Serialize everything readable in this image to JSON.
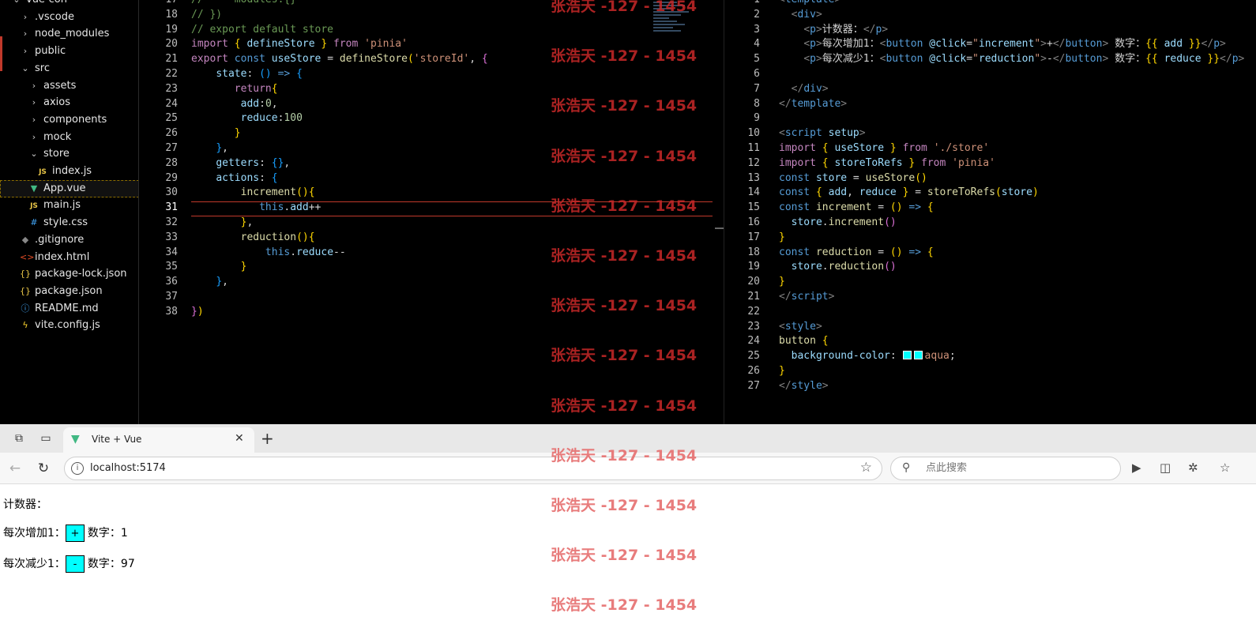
{
  "explorer": {
    "items": [
      {
        "label": "vue-con",
        "icon": "chevron-down-icon",
        "indent": 0
      },
      {
        "label": ".vscode",
        "icon": "chevron-right-icon",
        "indent": 1
      },
      {
        "label": "node_modules",
        "icon": "chevron-right-icon",
        "indent": 1
      },
      {
        "label": "public",
        "icon": "chevron-right-icon",
        "indent": 1
      },
      {
        "label": "src",
        "icon": "chevron-down-icon",
        "indent": 1
      },
      {
        "label": "assets",
        "icon": "chevron-right-icon",
        "indent": 2
      },
      {
        "label": "axios",
        "icon": "chevron-right-icon",
        "indent": 2
      },
      {
        "label": "components",
        "icon": "chevron-right-icon",
        "indent": 2
      },
      {
        "label": "mock",
        "icon": "chevron-right-icon",
        "indent": 2
      },
      {
        "label": "store",
        "icon": "chevron-down-icon",
        "indent": 2
      },
      {
        "label": "index.js",
        "icon": "js-file-icon",
        "indent": 3
      },
      {
        "label": "App.vue",
        "icon": "vue-file-icon",
        "indent": 2,
        "selected": true
      },
      {
        "label": "main.js",
        "icon": "js-file-icon",
        "indent": 2
      },
      {
        "label": "style.css",
        "icon": "css-file-icon",
        "indent": 2
      },
      {
        "label": ".gitignore",
        "icon": "git-file-icon",
        "indent": 1
      },
      {
        "label": "index.html",
        "icon": "html-file-icon",
        "indent": 1
      },
      {
        "label": "package-lock.json",
        "icon": "json-file-icon",
        "indent": 1
      },
      {
        "label": "package.json",
        "icon": "json-file-icon",
        "indent": 1
      },
      {
        "label": "README.md",
        "icon": "info-file-icon",
        "indent": 1
      },
      {
        "label": "vite.config.js",
        "icon": "vite-file-icon",
        "indent": 1
      }
    ]
  },
  "editor_left": {
    "active_line": 31,
    "lines": [
      {
        "n": "17",
        "html": "<span class='cm'>//     modules:{}</span>"
      },
      {
        "n": "18",
        "html": "<span class='cm'>// })</span>"
      },
      {
        "n": "19",
        "html": "<span class='cm'>// export default store</span>"
      },
      {
        "n": "20",
        "html": "<span class='kw'>import</span> <span class='br1'>{</span> <span class='var'>defineStore</span> <span class='br1'>}</span> <span class='kw'>from</span> <span class='str'>'pinia'</span>"
      },
      {
        "n": "21",
        "html": "<span class='kw'>export</span> <span class='kw2'>const</span> <span class='var'>useStore</span> = <span class='fn'>defineStore</span><span class='br1'>(</span><span class='str'>'storeId'</span>, <span class='br2'>{</span>"
      },
      {
        "n": "22",
        "html": "    <span class='var'>state</span>: <span class='br3'>()</span> <span class='kw2'>=&gt;</span> <span class='br3'>{</span>"
      },
      {
        "n": "23",
        "html": "       <span class='kw'>return</span><span class='br1'>{</span>"
      },
      {
        "n": "24",
        "html": "        <span class='var'>add</span>:<span class='num'>0</span>,"
      },
      {
        "n": "25",
        "html": "        <span class='var'>reduce</span>:<span class='num'>100</span>"
      },
      {
        "n": "26",
        "html": "       <span class='br1'>}</span>"
      },
      {
        "n": "27",
        "html": "    <span class='br3'>}</span>,"
      },
      {
        "n": "28",
        "html": "    <span class='var'>getters</span>: <span class='br3'>{}</span>,"
      },
      {
        "n": "29",
        "html": "    <span class='var'>actions</span>: <span class='br3'>{</span>"
      },
      {
        "n": "30",
        "html": "        <span class='fn'>increment</span><span class='br1'>()</span><span class='br1'>{</span>"
      },
      {
        "n": "31",
        "html": "           <span class='kw2'>this</span>.<span class='var'>add</span>++"
      },
      {
        "n": "32",
        "html": "        <span class='br1'>}</span>,"
      },
      {
        "n": "33",
        "html": "        <span class='fn'>reduction</span><span class='br1'>()</span><span class='br1'>{</span>"
      },
      {
        "n": "34",
        "html": "            <span class='kw2'>this</span>.<span class='var'>reduce</span>--"
      },
      {
        "n": "35",
        "html": "        <span class='br1'>}</span>"
      },
      {
        "n": "36",
        "html": "    <span class='br3'>}</span>,"
      },
      {
        "n": "37",
        "html": ""
      },
      {
        "n": "38",
        "html": "<span class='br2'>}</span><span class='br1'>)</span>"
      }
    ]
  },
  "editor_right": {
    "lines": [
      {
        "n": "1",
        "html": "<span class='tag'>&lt;</span><span class='tagn'>template</span><span class='tag'>&gt;</span>"
      },
      {
        "n": "2",
        "html": "  <span class='tag'>&lt;</span><span class='tagn'>div</span><span class='tag'>&gt;</span>"
      },
      {
        "n": "3",
        "html": "    <span class='tag'>&lt;</span><span class='tagn'>p</span><span class='tag'>&gt;</span>计数器：<span class='tag'>&lt;/</span><span class='tagn'>p</span><span class='tag'>&gt;</span>"
      },
      {
        "n": "4",
        "html": "    <span class='tag'>&lt;</span><span class='tagn'>p</span><span class='tag'>&gt;</span>每次增加1：<span class='tag'>&lt;</span><span class='tagn'>button</span> <span class='attr'>@click</span>=<span class='str'>\"<span class='var'>increment</span>\"</span><span class='tag'>&gt;</span>+<span class='tag'>&lt;/</span><span class='tagn'>button</span><span class='tag'>&gt;</span> 数字：<span class='br1'>{{</span> <span class='var'>add</span> <span class='br1'>}}</span><span class='tag'>&lt;/</span><span class='tagn'>p</span><span class='tag'>&gt;</span>"
      },
      {
        "n": "5",
        "html": "    <span class='tag'>&lt;</span><span class='tagn'>p</span><span class='tag'>&gt;</span>每次减少1：<span class='tag'>&lt;</span><span class='tagn'>button</span> <span class='attr'>@click</span>=<span class='str'>\"<span class='var'>reduction</span>\"</span><span class='tag'>&gt;</span>-<span class='tag'>&lt;/</span><span class='tagn'>button</span><span class='tag'>&gt;</span> 数字：<span class='br1'>{{</span> <span class='var'>reduce</span> <span class='br1'>}}</span><span class='tag'>&lt;/</span><span class='tagn'>p</span><span class='tag'>&gt;</span>"
      },
      {
        "n": "6",
        "html": ""
      },
      {
        "n": "7",
        "html": "  <span class='tag'>&lt;/</span><span class='tagn'>div</span><span class='tag'>&gt;</span>"
      },
      {
        "n": "8",
        "html": "<span class='tag'>&lt;/</span><span class='tagn'>template</span><span class='tag'>&gt;</span>"
      },
      {
        "n": "9",
        "html": ""
      },
      {
        "n": "10",
        "html": "<span class='tag'>&lt;</span><span class='tagn'>script</span> <span class='attr'>setup</span><span class='tag'>&gt;</span>"
      },
      {
        "n": "11",
        "html": "<span class='kw'>import</span> <span class='br1'>{</span> <span class='var'>useStore</span> <span class='br1'>}</span> <span class='kw'>from</span> <span class='str'>'./store'</span>"
      },
      {
        "n": "12",
        "html": "<span class='kw'>import</span> <span class='br1'>{</span> <span class='var'>storeToRefs</span> <span class='br1'>}</span> <span class='kw'>from</span> <span class='str'>'pinia'</span>"
      },
      {
        "n": "13",
        "html": "<span class='kw2'>const</span> <span class='var'>store</span> = <span class='fn'>useStore</span><span class='br1'>()</span>"
      },
      {
        "n": "14",
        "html": "<span class='kw2'>const</span> <span class='br1'>{</span> <span class='var'>add</span>, <span class='var'>reduce</span> <span class='br1'>}</span> = <span class='fn'>storeToRefs</span><span class='br1'>(</span><span class='var'>store</span><span class='br1'>)</span>"
      },
      {
        "n": "15",
        "html": "<span class='kw2'>const</span> <span class='fn'>increment</span> = <span class='br1'>()</span> <span class='kw2'>=&gt;</span> <span class='br1'>{</span>"
      },
      {
        "n": "16",
        "html": "  <span class='var'>store</span>.<span class='fn'>increment</span><span class='br2'>()</span>"
      },
      {
        "n": "17",
        "html": "<span class='br1'>}</span>"
      },
      {
        "n": "18",
        "html": "<span class='kw2'>const</span> <span class='fn'>reduction</span> = <span class='br1'>()</span> <span class='kw2'>=&gt;</span> <span class='br1'>{</span>"
      },
      {
        "n": "19",
        "html": "  <span class='var'>store</span>.<span class='fn'>reduction</span><span class='br2'>()</span>"
      },
      {
        "n": "20",
        "html": "<span class='br1'>}</span>"
      },
      {
        "n": "21",
        "html": "<span class='tag'>&lt;/</span><span class='tagn'>script</span><span class='tag'>&gt;</span>"
      },
      {
        "n": "22",
        "html": ""
      },
      {
        "n": "23",
        "html": "<span class='tag'>&lt;</span><span class='tagn'>style</span><span class='tag'>&gt;</span>"
      },
      {
        "n": "24",
        "html": "<span class='fn'>button</span> <span class='br1'>{</span>"
      },
      {
        "n": "25",
        "html": "  <span class='var'>background-color</span>: <span class='swatch'></span><span class='swatch'></span><span class='str'>aqua</span>;"
      },
      {
        "n": "26",
        "html": "<span class='br1'>}</span>"
      },
      {
        "n": "27",
        "html": "<span class='tag'>&lt;/</span><span class='tagn'>style</span><span class='tag'>&gt;</span>"
      }
    ]
  },
  "browser": {
    "tab_title": "Vite + Vue",
    "url": "localhost:5174",
    "search_placeholder": "点此搜索",
    "page": {
      "title": "计数器：",
      "increment_label": "每次增加1：",
      "increment_button": "+",
      "increment_value_label": "数字：",
      "add": "1",
      "reduce_label": "每次减少1：",
      "reduce_button": "-",
      "reduce_value_label": "数字：",
      "reduce": "97"
    }
  },
  "watermark": "张浩天 -127 - 1454",
  "colors": {
    "button_bg": "#00ffff",
    "watermark": "#c82828",
    "accent": "#c0392b"
  }
}
